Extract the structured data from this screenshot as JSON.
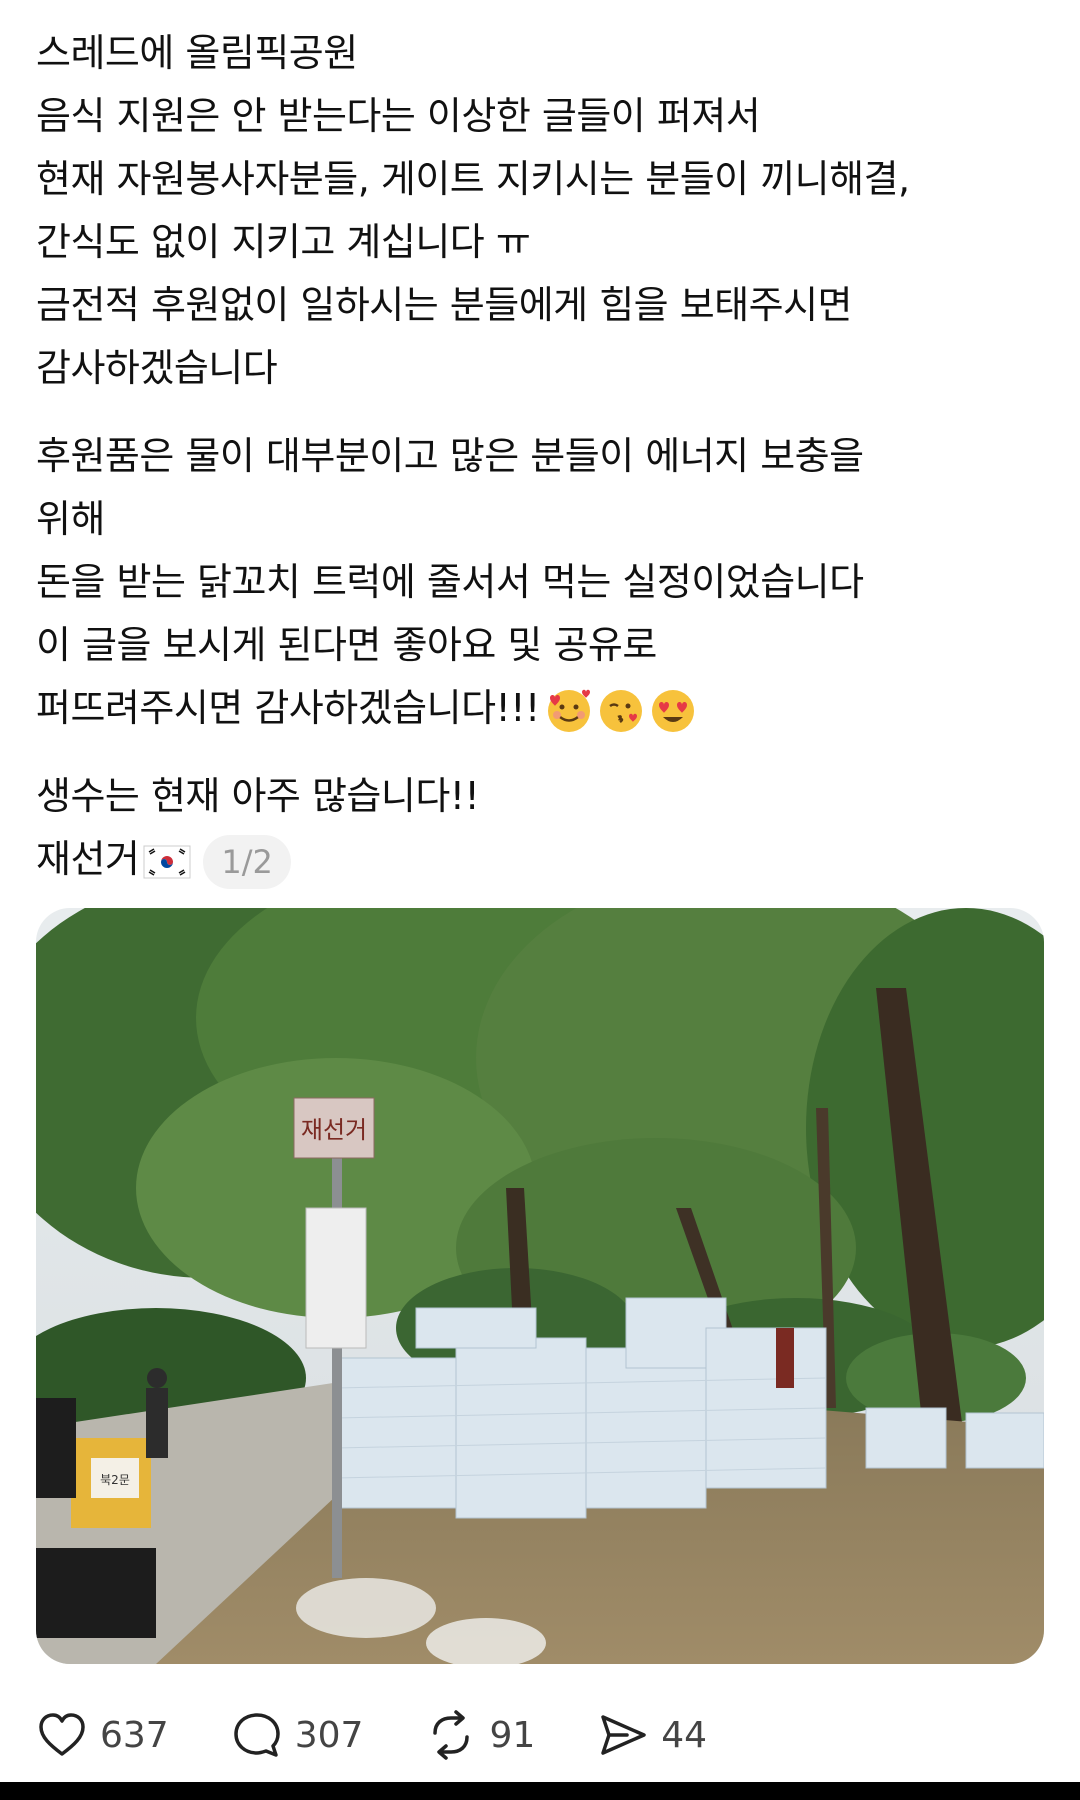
{
  "post": {
    "lines": [
      "스레드에 올림픽공원",
      "음식 지원은 안 받는다는 이상한 글들이 퍼져서",
      "현재 자원봉사자분들, 게이트 지키시는 분들이 끼니해결,",
      "간식도 없이 지키고 계십니다 ㅠ",
      "금전적 후원없이 일하시는 분들에게 힘을 보태주시면",
      "감사하겠습니다",
      "후원품은 물이 대부분이고 많은 분들이 에너지 보충을",
      "위해",
      "돈을 받는 닭꼬치 트럭에 줄서서 먹는 실정이었습니다",
      "이 글을 보시게 된다면 좋아요 및 공유로",
      "퍼뜨려주시면 감사하겠습니다!!!",
      "생수는 현재 아주 많습니다!!",
      "재선거"
    ],
    "emojis": [
      "smiling-face-with-hearts-icon",
      "face-blowing-kiss-icon",
      "heart-eyes-icon"
    ],
    "flag": "south-korea-flag-icon",
    "image_counter": "1/2"
  },
  "photo": {
    "sign_text": "재선거",
    "banner_text": "북2문"
  },
  "actions": {
    "likes": "637",
    "comments": "307",
    "reposts": "91",
    "shares": "44"
  },
  "colors": {
    "text": "#111111",
    "muted": "#9a9a9a",
    "pill_bg": "#f2f2f2"
  }
}
